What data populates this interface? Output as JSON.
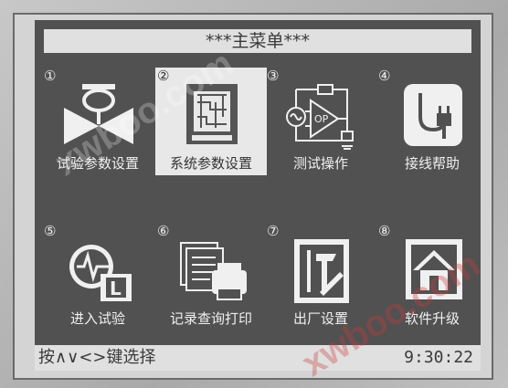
{
  "title": "***主菜单***",
  "menu": [
    {
      "num": "①",
      "label": "试验参数设置",
      "icon": "valve-icon",
      "selected": false
    },
    {
      "num": "②",
      "label": "系统参数设置",
      "icon": "circuit-board-icon",
      "selected": true
    },
    {
      "num": "③",
      "label": "测试操作",
      "icon": "opamp-circuit-icon",
      "selected": false
    },
    {
      "num": "④",
      "label": "接线帮助",
      "icon": "plug-icon",
      "selected": false
    },
    {
      "num": "⑤",
      "label": "进入试验",
      "icon": "clock-waveform-icon",
      "selected": false
    },
    {
      "num": "⑥",
      "label": "记录查询打印",
      "icon": "printer-icon",
      "selected": false
    },
    {
      "num": "⑦",
      "label": "出厂设置",
      "icon": "tools-icon",
      "selected": false
    },
    {
      "num": "⑧",
      "label": "软件升级",
      "icon": "house-icon",
      "selected": false
    }
  ],
  "status": {
    "hint": "按∧∨<>键选择",
    "time": "9:30:22"
  },
  "watermarks": [
    "xwboo.com",
    "xwboo.com"
  ],
  "colors": {
    "lcd_background": "#515151",
    "bar_background": "#e0e0e0",
    "selected_background": "#e8e8e8"
  }
}
